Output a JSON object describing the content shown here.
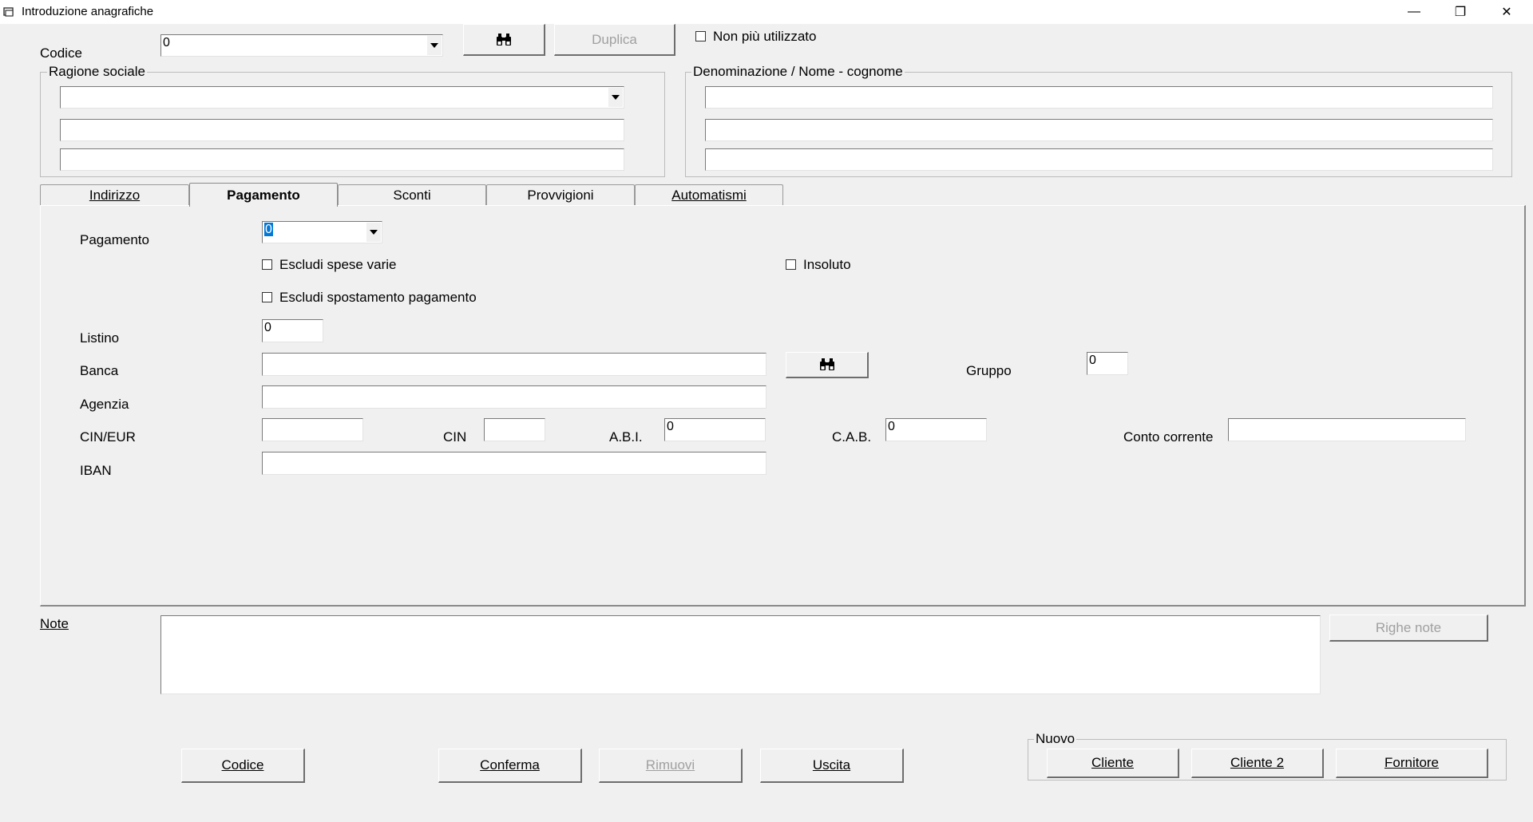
{
  "window": {
    "title": "Introduzione anagrafiche",
    "minimize_glyph": "—",
    "restore_glyph": "❐",
    "close_glyph": "✕"
  },
  "header": {
    "codice_label": "Codice",
    "codice_value": "0",
    "search_icon": "binoculars-icon",
    "duplica_label": "Duplica",
    "non_piu_utilizzato_label": "Non più utilizzato",
    "non_piu_utilizzato_checked": false
  },
  "ragione_sociale": {
    "legend": "Ragione sociale",
    "line1": "",
    "line2": "",
    "line3": ""
  },
  "denominazione": {
    "legend": "Denominazione / Nome - cognome",
    "line1": "",
    "line2": "",
    "line3": ""
  },
  "tabs": [
    {
      "label": "Indirizzo",
      "active": false
    },
    {
      "label": "Pagamento",
      "active": true
    },
    {
      "label": "Sconti",
      "active": false
    },
    {
      "label": "Provvigioni",
      "active": false
    },
    {
      "label": "Automatismi",
      "active": false
    }
  ],
  "pagamento_tab": {
    "pagamento_label": "Pagamento",
    "pagamento_value": "0",
    "escludi_spese_varie_label": "Escludi spese varie",
    "escludi_spostamento_label": "Escludi spostamento pagamento",
    "insoluto_label": "Insoluto",
    "listino_label": "Listino",
    "listino_value": "0",
    "banca_label": "Banca",
    "banca_value": "",
    "gruppo_label": "Gruppo",
    "gruppo_value": "0",
    "agenzia_label": "Agenzia",
    "agenzia_value": "",
    "cin_eur_label": "CIN/EUR",
    "cin_eur_value": "",
    "cin_label": "CIN",
    "cin_value": "",
    "abi_label": "A.B.I.",
    "abi_value": "0",
    "cab_label": "C.A.B.",
    "cab_value": "0",
    "conto_corrente_label": "Conto corrente",
    "conto_corrente_value": "",
    "iban_label": "IBAN",
    "iban_value": ""
  },
  "note": {
    "label": "Note",
    "value": "",
    "righe_note_label": "Righe note"
  },
  "footer": {
    "codice_label": "Codice",
    "conferma_label": "Conferma",
    "rimuovi_label": "Rimuovi",
    "uscita_label": "Uscita"
  },
  "nuovo": {
    "legend": "Nuovo",
    "cliente_label": "Cliente",
    "cliente2_label": "Cliente 2",
    "fornitore_label": "Fornitore"
  }
}
